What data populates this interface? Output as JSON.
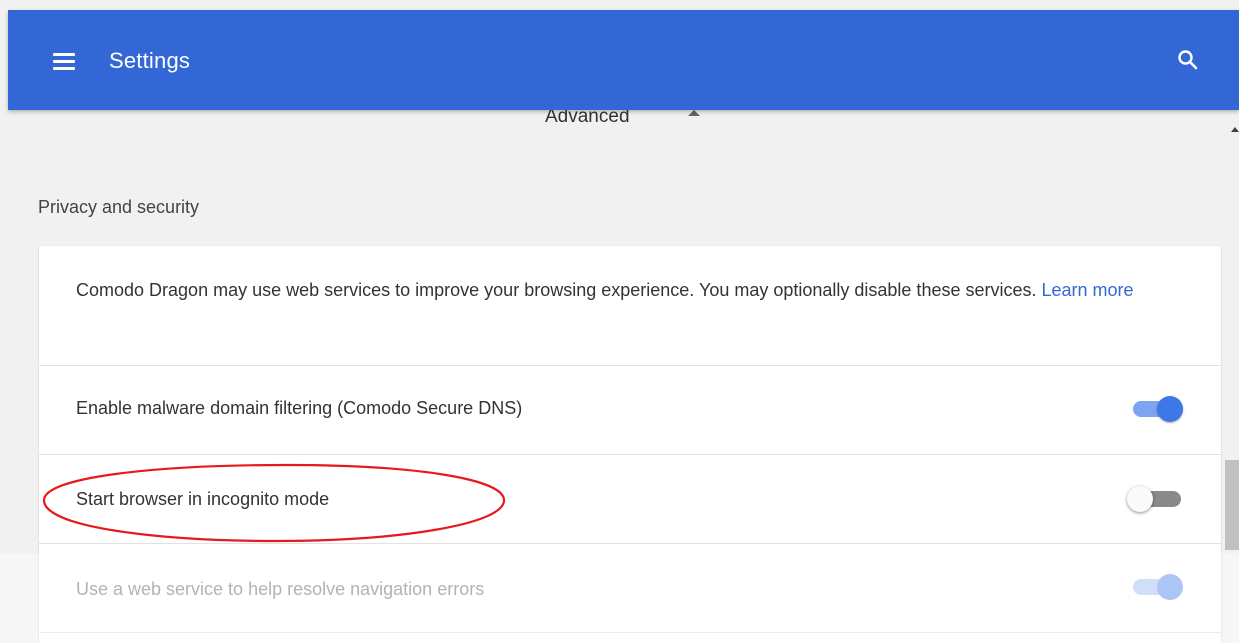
{
  "header": {
    "title": "Settings",
    "menu_icon": "hamburger-menu-icon",
    "search_icon": "search-icon",
    "background_color": "#3367d6"
  },
  "advanced": {
    "label": "Advanced",
    "icon": "arrow-up-icon"
  },
  "section": {
    "title": "Privacy and security"
  },
  "card": {
    "description": "Comodo Dragon may use web services to improve your browsing experience. You may optionally disable these services.",
    "learn_more": "Learn more",
    "link_color": "#3367d6",
    "rows": [
      {
        "label": "Enable malware domain filtering (Comodo Secure DNS)",
        "enabled": true,
        "disabled_look": false
      },
      {
        "label": "Start browser in incognito mode",
        "enabled": false,
        "disabled_look": false,
        "annotated": true
      },
      {
        "label": "Use a web service to help resolve navigation errors",
        "enabled": true,
        "disabled_look": true
      }
    ]
  },
  "annotation": {
    "shape": "ellipse",
    "color": "#e8191b"
  }
}
